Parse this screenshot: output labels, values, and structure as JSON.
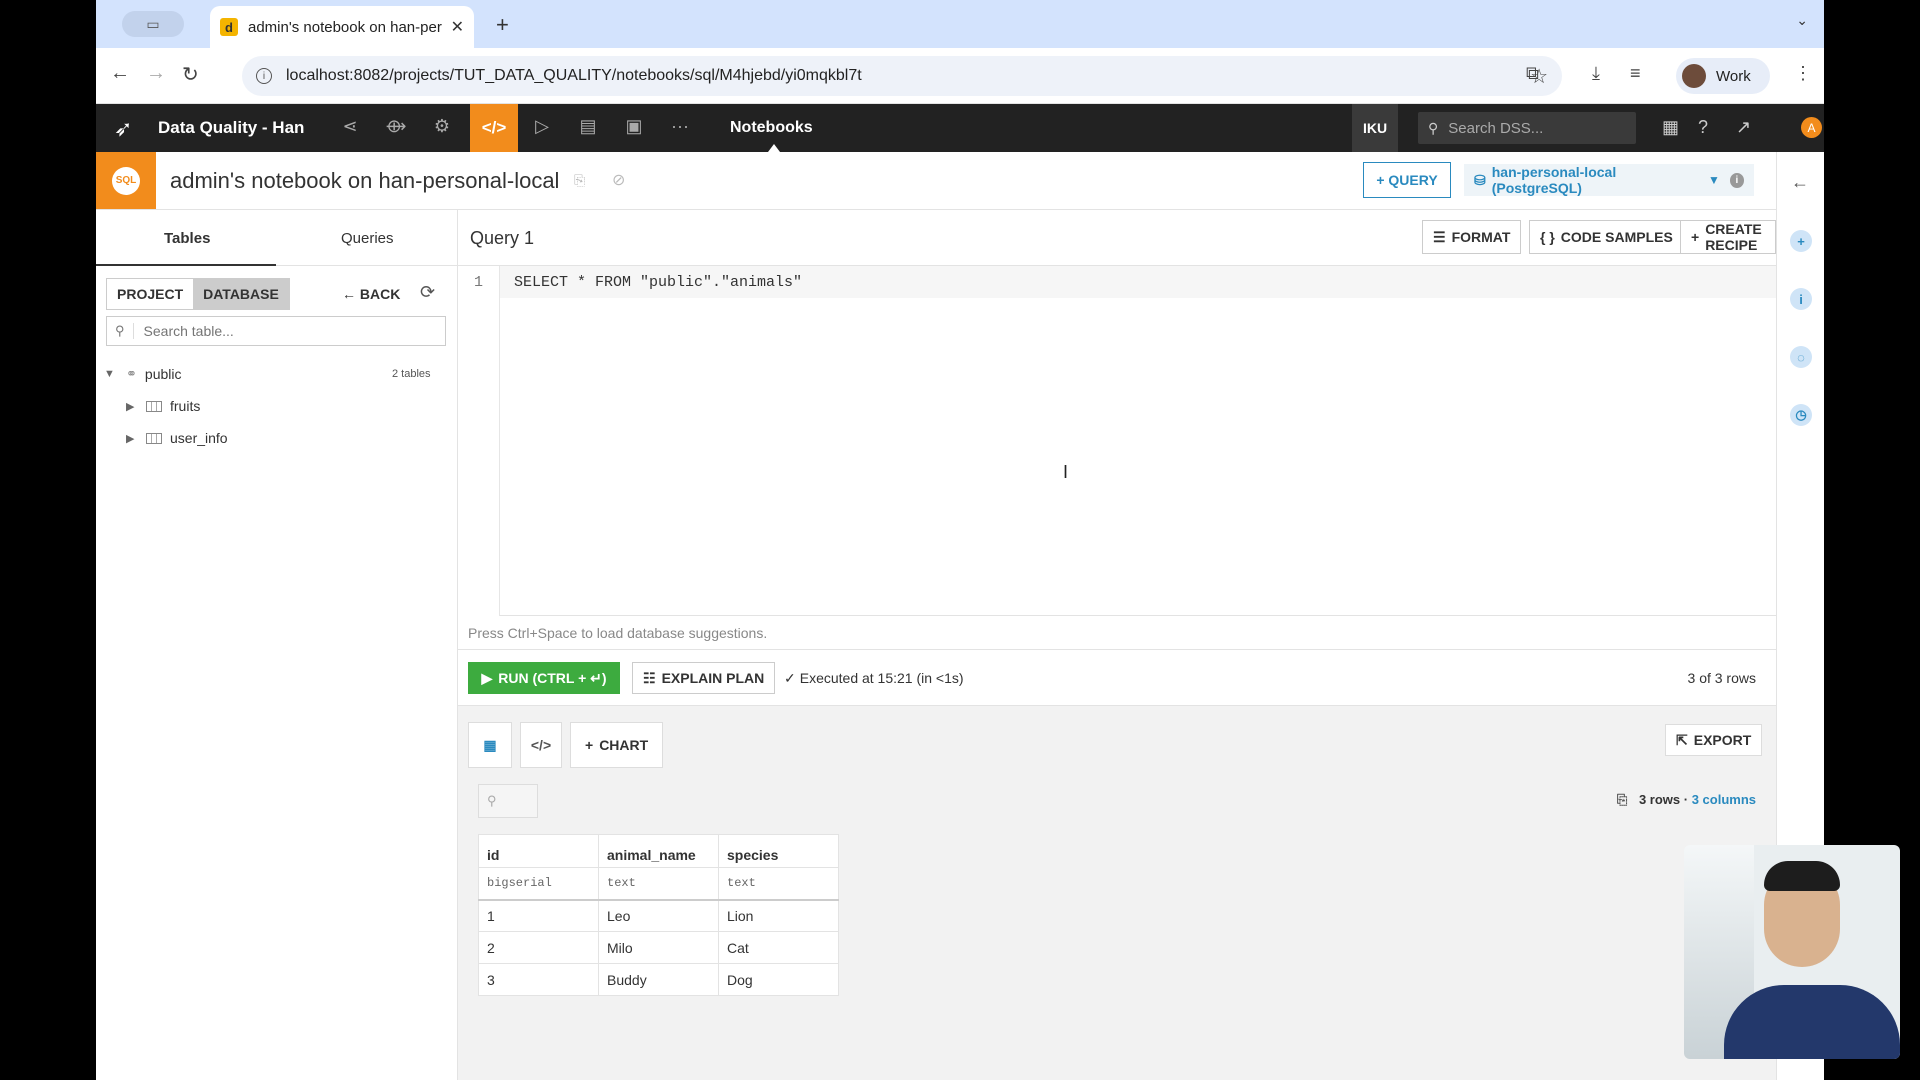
{
  "browser": {
    "tab_title": "admin's notebook on han-per",
    "favicon_letter": "d",
    "url": "localhost:8082/projects/TUT_DATA_QUALITY/notebooks/sql/M4hjebd/yi0mqkbl7t",
    "profile_label": "Work"
  },
  "dss_nav": {
    "project_name": "Data Quality - Han",
    "section_title": "Notebooks",
    "instance_label": "IKU",
    "search_placeholder": "Search DSS...",
    "user_initial": "A"
  },
  "notebook": {
    "badge": "SQL",
    "title": "admin's notebook on han-personal-local",
    "query_button": "+ QUERY",
    "connection": "han-personal-local (PostgreSQL)"
  },
  "left_panel": {
    "tabs": [
      "Tables",
      "Queries"
    ],
    "segment": [
      "PROJECT",
      "DATABASE"
    ],
    "back_label": "BACK",
    "search_placeholder": "Search table...",
    "schema": {
      "name": "public",
      "count": "2 tables"
    },
    "tables": [
      "fruits",
      "user_info"
    ]
  },
  "editor": {
    "query_title": "Query 1",
    "buttons": {
      "format": "FORMAT",
      "code_samples": "CODE SAMPLES",
      "create_recipe": "CREATE RECIPE"
    },
    "line_number": "1",
    "code": "SELECT * FROM \"public\".\"animals\"",
    "hint": "Press Ctrl+Space to load database suggestions."
  },
  "run_bar": {
    "run_label": "RUN (CTRL + ↵)",
    "explain_label": "EXPLAIN PLAN",
    "executed": "Executed at 15:21 (in <1s)",
    "row_count": "3 of 3 rows"
  },
  "results": {
    "chart_label": "CHART",
    "export_label": "EXPORT",
    "rows_label": "3 rows",
    "cols_label": "3 columns",
    "columns": [
      {
        "name": "id",
        "type": "bigserial"
      },
      {
        "name": "animal_name",
        "type": "text"
      },
      {
        "name": "species",
        "type": "text"
      }
    ],
    "rows": [
      [
        "1",
        "Leo",
        "Lion"
      ],
      [
        "2",
        "Milo",
        "Cat"
      ],
      [
        "3",
        "Buddy",
        "Dog"
      ]
    ]
  }
}
